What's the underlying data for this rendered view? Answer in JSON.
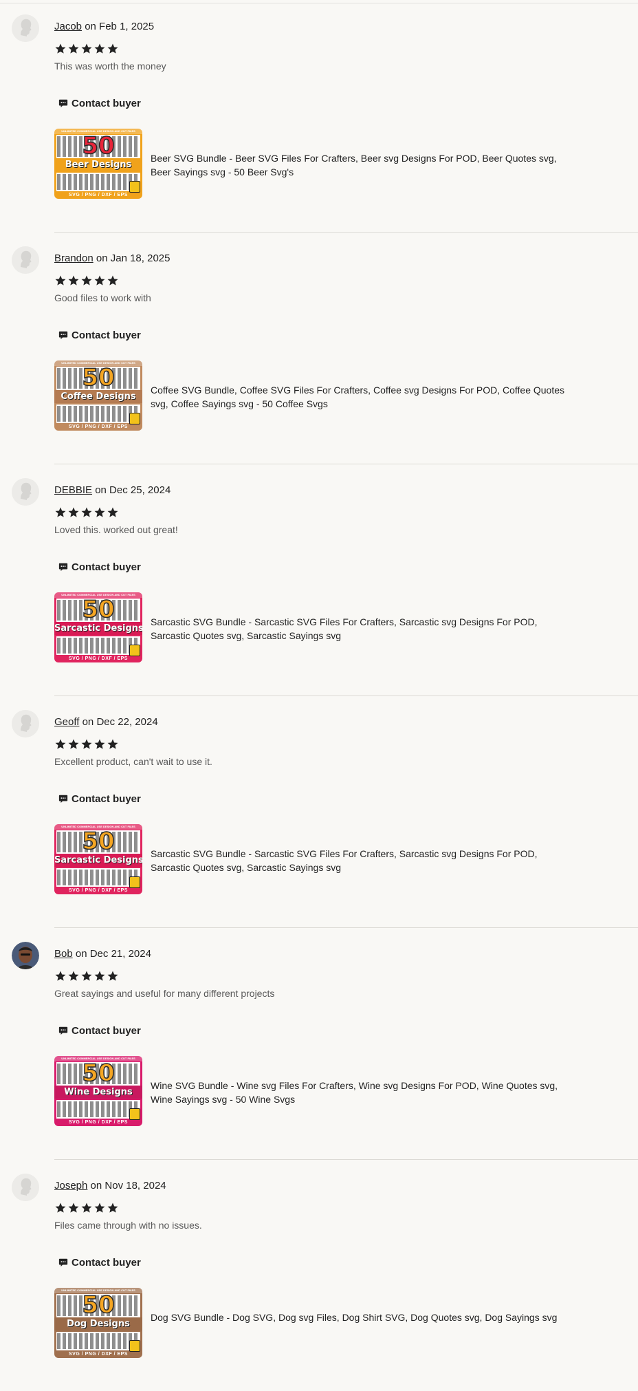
{
  "contact_label": "Contact buyer",
  "colors": {
    "star": "#222222",
    "text": "#222222",
    "muted_text": "#595959",
    "background": "#f9f8f5",
    "divider": "#dcdad5"
  },
  "reviews": [
    {
      "name": "Jacob",
      "date_text": "on Feb 1, 2025",
      "rating": 5,
      "comment": "This was worth the money",
      "avatar": "placeholder",
      "listing_title": "Beer SVG Bundle - Beer SVG Files For Crafters, Beer svg Designs For POD, Beer Quotes svg, Beer Sayings svg - 50 Beer Svg's",
      "thumb": {
        "top_text": "UNLIMITED COMMERCIAL USE DESIGN AND CUT FILES",
        "number": "50",
        "label": "Beer Designs",
        "formats": "SVG / PNG / DXF / EPS",
        "primary_color": "#f0a21b",
        "ribbon_color": "#f0a21b",
        "number_color": "#e8253a"
      }
    },
    {
      "name": "Brandon",
      "date_text": "on Jan 18, 2025",
      "rating": 5,
      "comment": "Good files to work with",
      "avatar": "placeholder",
      "listing_title": "Coffee SVG Bundle, Coffee SVG Files For Crafters, Coffee svg Designs For POD, Coffee Quotes svg, Coffee Sayings svg - 50 Coffee Svgs",
      "thumb": {
        "top_text": "UNLIMITED COMMERCIAL USE DESIGN AND CUT FILES",
        "number": "50",
        "label": "Coffee Designs",
        "formats": "SVG / PNG / DXF / EPS",
        "primary_color": "#c08a5e",
        "ribbon_color": "#b47b52",
        "number_color": "#f5a623"
      }
    },
    {
      "name": "DEBBIE",
      "date_text": "on Dec 25, 2024",
      "rating": 5,
      "comment": "Loved this. worked out great!",
      "avatar": "placeholder",
      "listing_title": "Sarcastic SVG Bundle - Sarcastic SVG Files For Crafters, Sarcastic svg Designs For POD, Sarcastic Quotes svg, Sarcastic Sayings svg",
      "thumb": {
        "top_text": "UNLIMITED COMMERCIAL USE DESIGN AND CUT FILES",
        "number": "50",
        "label": "Sarcastic Designs",
        "formats": "SVG / PNG / DXF / EPS",
        "primary_color": "#e0245e",
        "ribbon_color": "#d81b55",
        "number_color": "#f5a623"
      }
    },
    {
      "name": "Geoff",
      "date_text": "on Dec 22, 2024",
      "rating": 5,
      "comment": "Excellent product, can't wait to use it.",
      "avatar": "placeholder",
      "listing_title": "Sarcastic SVG Bundle - Sarcastic SVG Files For Crafters, Sarcastic svg Designs For POD, Sarcastic Quotes svg, Sarcastic Sayings svg",
      "thumb": {
        "top_text": "UNLIMITED COMMERCIAL USE DESIGN AND CUT FILES",
        "number": "50",
        "label": "Sarcastic Designs",
        "formats": "SVG / PNG / DXF / EPS",
        "primary_color": "#e0245e",
        "ribbon_color": "#d81b55",
        "number_color": "#f5a623"
      }
    },
    {
      "name": "Bob",
      "date_text": "on Dec 21, 2024",
      "rating": 5,
      "comment": "Great sayings and useful for many different projects",
      "avatar": "photo",
      "listing_title": "Wine SVG Bundle - Wine svg Files For Crafters, Wine svg Designs For POD, Wine Quotes svg, Wine Sayings svg - 50 Wine Svgs",
      "thumb": {
        "top_text": "UNLIMITED COMMERCIAL USE DESIGN AND CUT FILES",
        "number": "50",
        "label": "Wine Designs",
        "formats": "SVG / PNG / DXF / EPS",
        "primary_color": "#d81b6a",
        "ribbon_color": "#c8195f",
        "number_color": "#f5a623"
      }
    },
    {
      "name": "Joseph",
      "date_text": "on Nov 18, 2024",
      "rating": 5,
      "comment": "Files came through with no issues.",
      "avatar": "placeholder",
      "listing_title": "Dog SVG Bundle - Dog SVG, Dog svg Files, Dog Shirt SVG, Dog Quotes svg, Dog Sayings svg",
      "thumb": {
        "top_text": "UNLIMITED COMMERCIAL USE DESIGN AND CUT FILES",
        "number": "50",
        "label": "Dog Designs",
        "formats": "SVG / PNG / DXF / EPS",
        "primary_color": "#a0704e",
        "ribbon_color": "#9a6a48",
        "number_color": "#f5a623"
      }
    }
  ]
}
